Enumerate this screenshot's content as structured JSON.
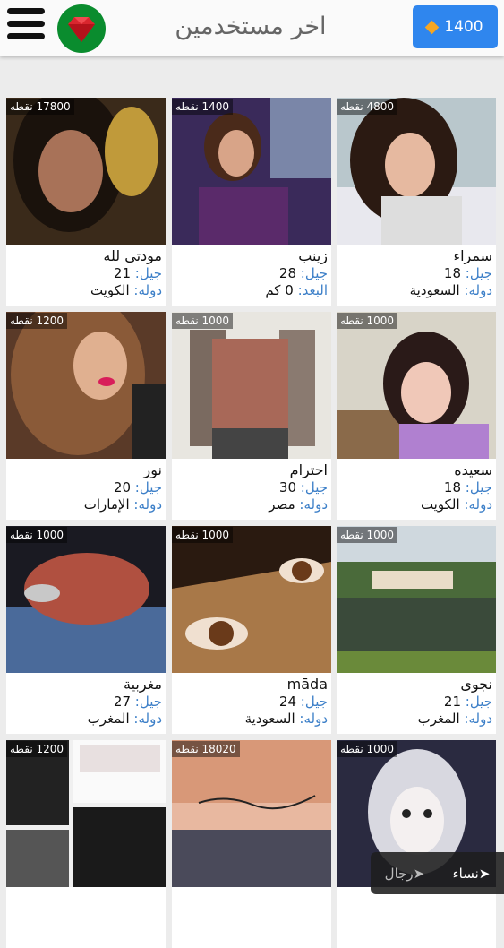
{
  "header": {
    "title": "اخر مستخدمين",
    "points_value": "1400",
    "menu_icon": "hamburger-menu-icon",
    "logo_icon": "ruby-gem-icon",
    "points_icon": "diamond-icon"
  },
  "labels": {
    "age": "جيل:",
    "country": "دوله:",
    "distance": "البعد:"
  },
  "users": [
    {
      "name": "سمراء",
      "points": "4800 نقطه",
      "age": "18",
      "country": "السعودية"
    },
    {
      "name": "زينب",
      "points": "1400 نقطه",
      "age": "28",
      "distance": "0 كم"
    },
    {
      "name": "مودتى لله",
      "points": "17800 نقطه",
      "age": "21",
      "country": "الكويت"
    },
    {
      "name": "سعيده",
      "points": "1000 نقطه",
      "age": "18",
      "country": "الكويت"
    },
    {
      "name": "احترام",
      "points": "1000 نقطه",
      "age": "30",
      "country": "مصر"
    },
    {
      "name": "نور",
      "points": "1200 نقطه",
      "age": "20",
      "country": "الإمارات"
    },
    {
      "name": "نجوى",
      "points": "1000 نقطه",
      "age": "21",
      "country": "المغرب"
    },
    {
      "name": "māda",
      "points": "1000 نقطه",
      "age": "24",
      "country": "السعودية"
    },
    {
      "name": "مغربية",
      "points": "1000 نقطه",
      "age": "27",
      "country": "المغرب"
    },
    {
      "name": "",
      "points": "1000 نقطه"
    },
    {
      "name": "",
      "points": "18020 نقطه"
    },
    {
      "name": "",
      "points": "1200 نقطه"
    }
  ],
  "gender_filter": {
    "women": "نساء",
    "men": "رجال"
  },
  "colors": {
    "accent": "#2f86ee",
    "label": "#3c7fc8",
    "logo_bg": "#0a8c2e"
  }
}
